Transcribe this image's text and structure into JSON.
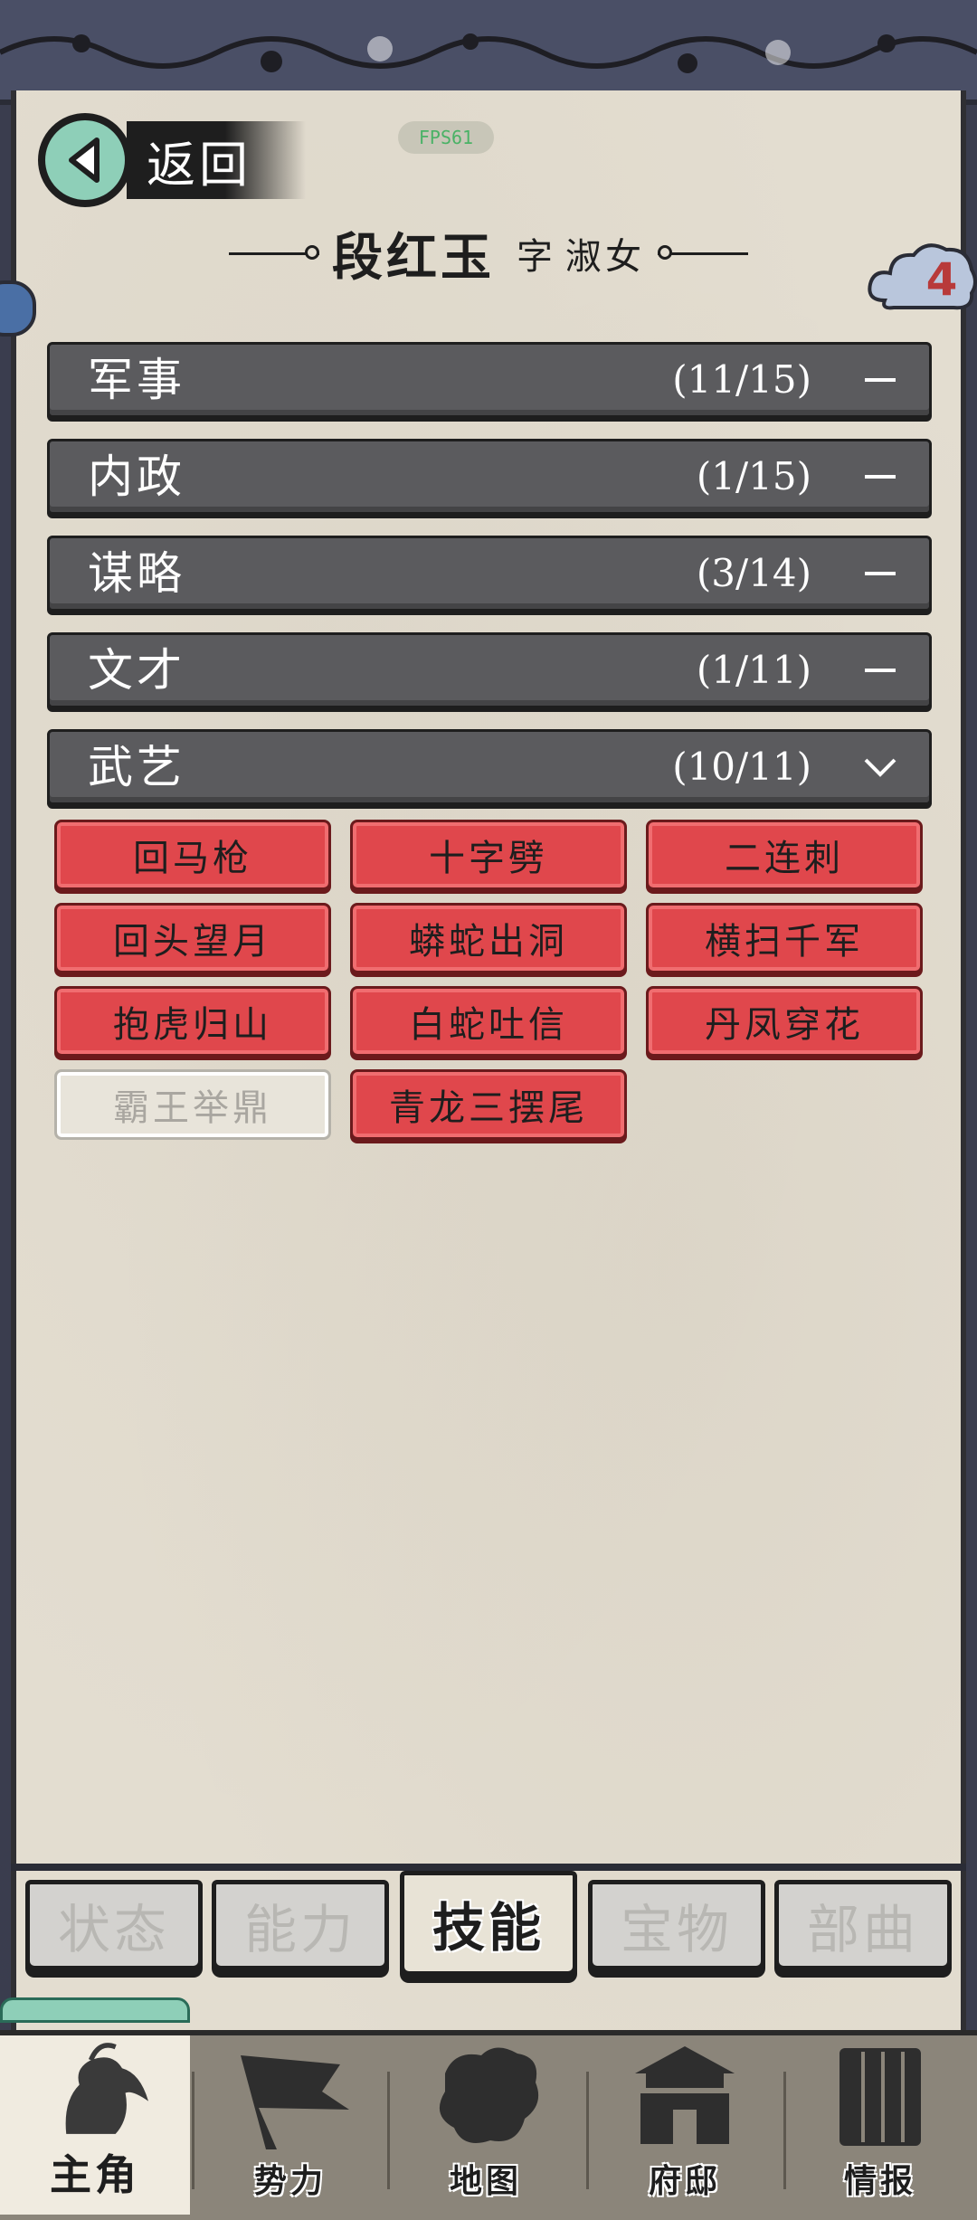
{
  "header": {
    "back_label": "返回",
    "fps_label": "FPS61"
  },
  "character": {
    "name": "段红玉",
    "courtesy_prefix": "字",
    "courtesy_name": "淑女",
    "badge_count": "4"
  },
  "categories": [
    {
      "name": "军事",
      "count": "(11/15)",
      "expanded": false
    },
    {
      "name": "内政",
      "count": "(1/15)",
      "expanded": false
    },
    {
      "name": "谋略",
      "count": "(3/14)",
      "expanded": false
    },
    {
      "name": "文才",
      "count": "(1/11)",
      "expanded": false
    },
    {
      "name": "武艺",
      "count": "(10/11)",
      "expanded": true
    }
  ],
  "skills": [
    {
      "label": "回马枪",
      "learned": true
    },
    {
      "label": "十字劈",
      "learned": true
    },
    {
      "label": "二连刺",
      "learned": true
    },
    {
      "label": "回头望月",
      "learned": true
    },
    {
      "label": "蟒蛇出洞",
      "learned": true
    },
    {
      "label": "横扫千军",
      "learned": true
    },
    {
      "label": "抱虎归山",
      "learned": true
    },
    {
      "label": "白蛇吐信",
      "learned": true
    },
    {
      "label": "丹凤穿花",
      "learned": true
    },
    {
      "label": "霸王举鼎",
      "learned": false
    },
    {
      "label": "青龙三摆尾",
      "learned": true
    }
  ],
  "tabs": [
    {
      "label": "状态",
      "active": false
    },
    {
      "label": "能力",
      "active": false
    },
    {
      "label": "技能",
      "active": true
    },
    {
      "label": "宝物",
      "active": false
    },
    {
      "label": "部曲",
      "active": false
    }
  ],
  "bottom_nav": [
    {
      "label": "主角",
      "icon": "warrior-icon",
      "active": true
    },
    {
      "label": "势力",
      "icon": "flag-icon",
      "active": false
    },
    {
      "label": "地图",
      "icon": "map-icon",
      "active": false
    },
    {
      "label": "府邸",
      "icon": "mansion-icon",
      "active": false
    },
    {
      "label": "情报",
      "icon": "scroll-icon",
      "active": false
    }
  ],
  "colors": {
    "skill_learned": "#e0474c",
    "skill_locked": "#e8e4da",
    "category_bar": "#5b5b5e",
    "accent_teal": "#8ecfb8",
    "badge_red": "#b83a3a"
  }
}
